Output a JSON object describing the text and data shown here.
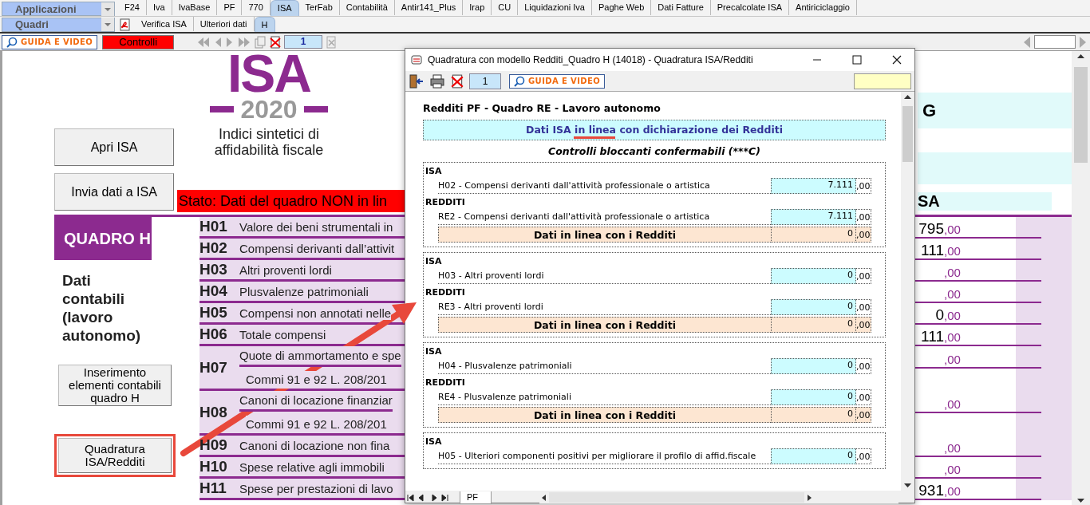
{
  "menus": {
    "applications": "Applicazioni",
    "sections": "Quadri"
  },
  "tabs": [
    {
      "label": "F24",
      "selected": false
    },
    {
      "label": "Iva",
      "selected": false
    },
    {
      "label": "IvaBase",
      "selected": false
    },
    {
      "label": "PF",
      "selected": false
    },
    {
      "label": "770",
      "selected": false
    },
    {
      "label": "ISA",
      "selected": true
    },
    {
      "label": "TerFab",
      "selected": false
    },
    {
      "label": "Contabilità",
      "selected": false
    },
    {
      "label": "Antir141_Plus",
      "selected": false
    },
    {
      "label": "Irap",
      "selected": false
    },
    {
      "label": "CU",
      "selected": false
    },
    {
      "label": "Liquidazioni Iva",
      "selected": false
    },
    {
      "label": "Paghe Web",
      "selected": false
    },
    {
      "label": "Dati Fatture",
      "selected": false
    },
    {
      "label": "Precalcolate ISA",
      "selected": false
    },
    {
      "label": "Antiriciclaggio",
      "selected": false
    }
  ],
  "subtabs": [
    {
      "label": "Verifica ISA",
      "selected": false
    },
    {
      "label": "Ulteriori dati",
      "selected": false
    },
    {
      "label": "H",
      "selected": true
    }
  ],
  "toolbar": {
    "guide_button": "GUIDA E VIDEO",
    "controls_button": "Controlli",
    "page": "1"
  },
  "sheet": {
    "logo": {
      "title": "ISA",
      "year": "2020",
      "subtitle": "Indici sintetici di affidabilità fiscale"
    },
    "buttons": [
      "Apri ISA",
      "Invia dati a ISA"
    ],
    "status": "Stato: Dati del quadro NON in lin",
    "right_header": {
      "heading": "G",
      "label": "SA"
    },
    "section_title": "QUADRO H",
    "section_subtitle": "Dati contabili (lavoro autonomo)",
    "side_buttons": [
      {
        "label": "Inserimento elementi contabili quadro H",
        "highlighted": false
      },
      {
        "label": "Quadratura ISA/Redditi",
        "highlighted": true
      }
    ],
    "rows": [
      {
        "code": "H01",
        "label": "Valore dei beni strumentali in",
        "amount": "795",
        "decimals": ",00"
      },
      {
        "code": "H02",
        "label": "Compensi derivanti dall’attivit",
        "amount": "111",
        "decimals": ",00"
      },
      {
        "code": "H03",
        "label": "Altri proventi lordi",
        "decimals": ",00"
      },
      {
        "code": "H04",
        "label": "Plusvalenze patrimoniali",
        "decimals": ",00"
      },
      {
        "code": "H05",
        "label": "Compensi non annotati nelle",
        "amount": "0",
        "decimals": ",00"
      },
      {
        "code": "H06",
        "label": "Totale compensi",
        "amount": "111",
        "decimals": ",00"
      },
      {
        "code": "H07",
        "label": "Quote di ammortamento e spe",
        "sublabel": "Commi 91 e 92 L. 208/201",
        "decimals": ",00"
      },
      {
        "code": "H08",
        "label": "Canoni di locazione finanziar",
        "sublabel": "Commi 91 e 92 L. 208/201",
        "decimals": ",00"
      },
      {
        "code": "H09",
        "label": "Canoni di locazione non fina",
        "decimals": ",00"
      },
      {
        "code": "H10",
        "label": "Spese relative agli immobili",
        "decimals": ",00"
      },
      {
        "code": "H11",
        "label": "Spese per prestazioni di lavo",
        "amount": "931",
        "decimals": ",00"
      }
    ]
  },
  "dialog": {
    "title": "Quadratura con modello Redditi_Quadro H (14018) - Quadratura ISA/Redditi",
    "page": "1",
    "guide_button": "GUIDA E VIDEO",
    "heading": "Redditi PF - Quadro RE - Lavoro autonomo",
    "banner": "Dati ISA in linea con dichiarazione dei Redditi",
    "subheading": "Controlli bloccanti confermabili (***C)",
    "groups": [
      {
        "sections": [
          {
            "heading": "ISA",
            "label": "H02 - Compensi derivanti dall'attività professionale o artistica",
            "amount": "7.111",
            "decimals": ",00"
          },
          {
            "heading": "REDDITI",
            "label": "RE2 - Compensi derivanti dall'attività professionale o artistica",
            "amount": "7.111",
            "decimals": ",00"
          }
        ],
        "summary": {
          "label": "Dati in linea con i Redditi",
          "amount": "0",
          "decimals": ",00"
        }
      },
      {
        "sections": [
          {
            "heading": "ISA",
            "label": "H03 - Altri proventi lordi",
            "amount": "0",
            "decimals": ",00"
          },
          {
            "heading": "REDDITI",
            "label": "RE3 - Altri proventi lordi",
            "amount": "0",
            "decimals": ",00"
          }
        ],
        "summary": {
          "label": "Dati in linea con i Redditi",
          "amount": "0",
          "decimals": ",00"
        }
      },
      {
        "sections": [
          {
            "heading": "ISA",
            "label": "H04 - Plusvalenze patrimoniali",
            "amount": "0",
            "decimals": ",00"
          },
          {
            "heading": "REDDITI",
            "label": "RE4 - Plusvalenze patrimoniali",
            "amount": "0",
            "decimals": ",00"
          }
        ],
        "summary": {
          "label": "Dati in linea con i Redditi",
          "amount": "0",
          "decimals": ",00"
        }
      },
      {
        "sections": [
          {
            "heading": "ISA",
            "label": "H05 - Ulteriori componenti positivi per migliorare il profilo di affid.fiscale",
            "amount": "0",
            "decimals": ",00"
          }
        ]
      }
    ],
    "sheet_tab": "PF"
  }
}
